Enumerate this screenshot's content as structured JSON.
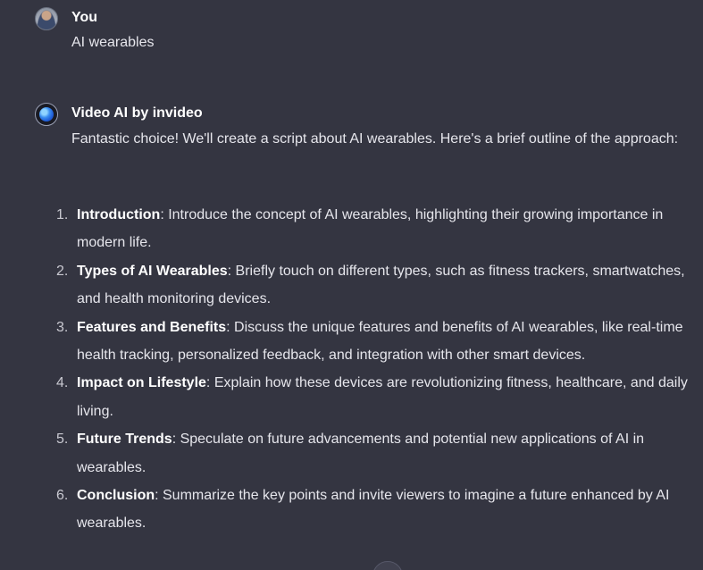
{
  "user_message": {
    "author": "You",
    "text": "AI wearables"
  },
  "assistant_message": {
    "author": "Video AI by invideo",
    "intro": "Fantastic choice! We'll create a script about AI wearables. Here's a brief outline of the approach:",
    "items": [
      {
        "number": "1.",
        "title": "Introduction",
        "text": ": Introduce the concept of AI wearables, highlighting their growing importance in modern life."
      },
      {
        "number": "2.",
        "title": "Types of AI Wearables",
        "text": ": Briefly touch on different types, such as fitness trackers, smartwatches, and health monitoring devices."
      },
      {
        "number": "3.",
        "title": "Features and Benefits",
        "text": ": Discuss the unique features and benefits of AI wearables, like real-time health tracking, personalized feedback, and integration with other smart devices."
      },
      {
        "number": "4.",
        "title": "Impact on Lifestyle",
        "text": ": Explain how these devices are revolutionizing fitness, healthcare, and daily living."
      },
      {
        "number": "5.",
        "title": "Future Trends",
        "text": ": Speculate on future advancements and potential new applications of AI in wearables."
      },
      {
        "number": "6.",
        "title": "Conclusion",
        "text": ": Summarize the key points and invite viewers to imagine a future enhanced by AI wearables."
      }
    ]
  },
  "colors": {
    "background": "#343541",
    "text": "#e6e6ec",
    "heading": "#ffffff"
  },
  "icons": {
    "user_avatar": "user-avatar-photo",
    "assistant_avatar": "globe-avatar",
    "scroll_button": "scroll-down-icon"
  }
}
